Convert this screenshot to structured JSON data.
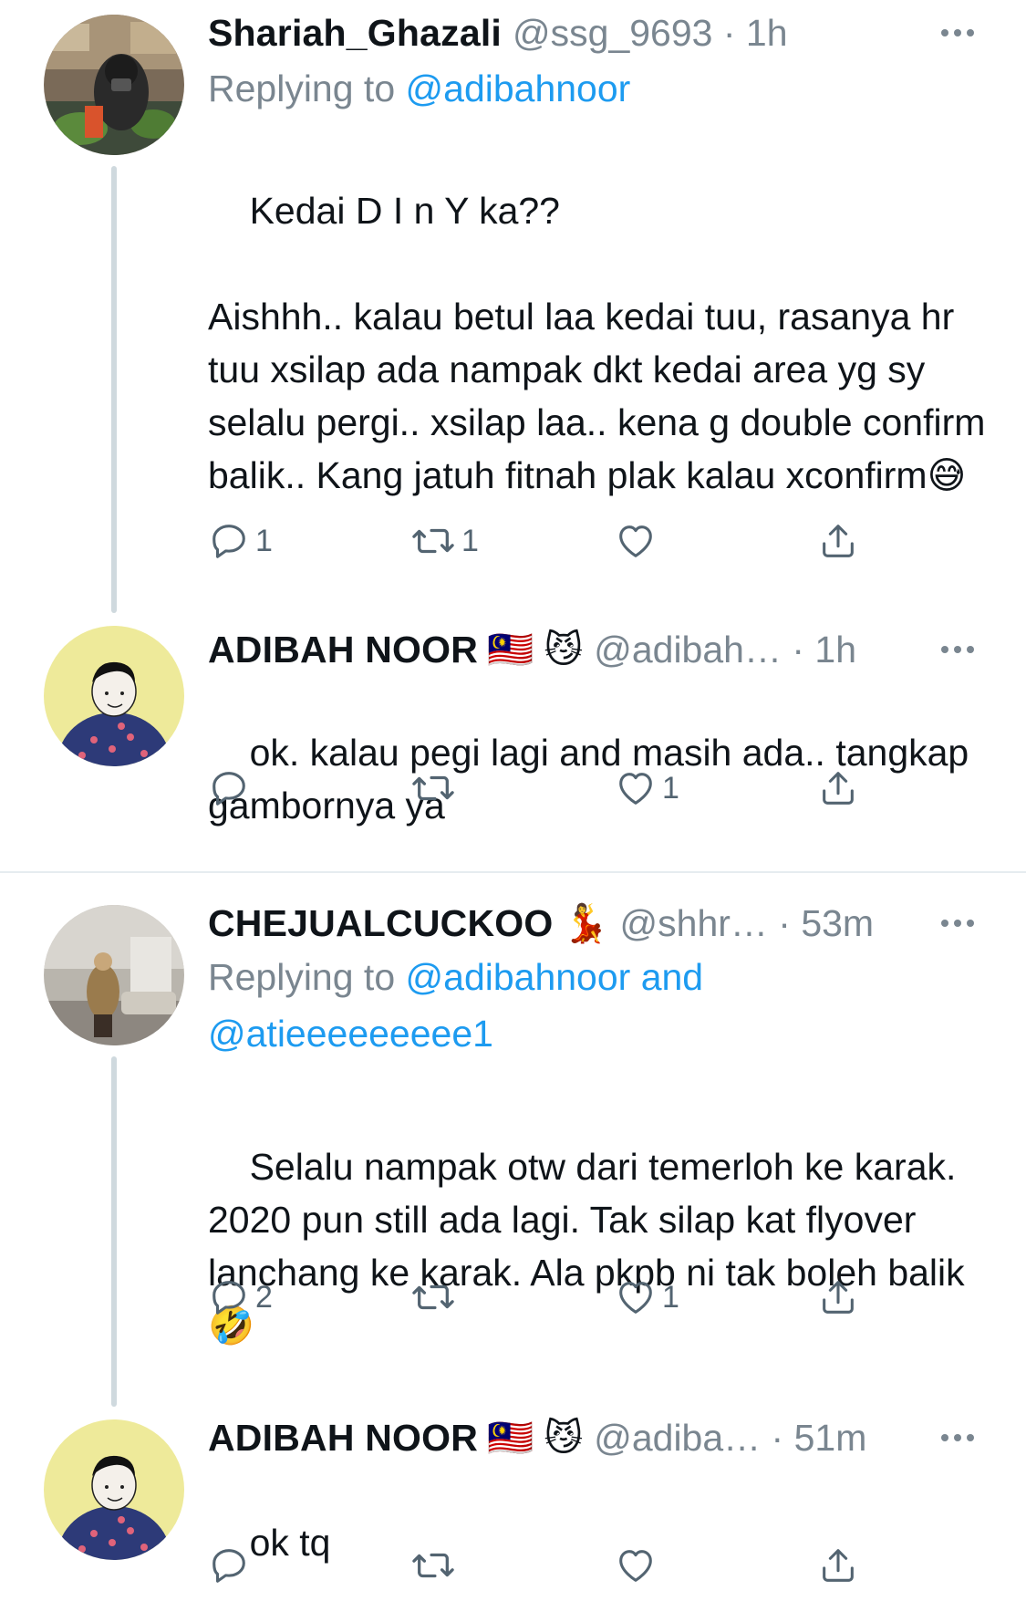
{
  "tweets": [
    {
      "name": "Shariah_Ghazali",
      "meta": "@ssg_9693 · 1h",
      "reply_prefix": "Replying to ",
      "reply_mentions": "@adibahnoor",
      "text": "Kedai D I n Y ka??\n\nAishhh.. kalau betul laa kedai tuu, rasanya hr tuu xsilap ada nampak dkt kedai area yg sy selalu pergi.. xsilap laa.. kena g double confirm balik.. Kang jatuh fitnah plak kalau xconfirm",
      "text_emoji": "😅",
      "reply_count": "1",
      "retweet_count": "1",
      "like_count": ""
    },
    {
      "name": "ADIBAH NOOR",
      "name_emoji": "🇲🇾 😼",
      "meta": "@adibah… · 1h",
      "text": "ok. kalau pegi lagi and masih ada.. tangkap gambornya ya",
      "reply_count": "",
      "retweet_count": "",
      "like_count": "1"
    },
    {
      "name": "CHEJUALCUCKOO",
      "name_emoji": "💃",
      "meta": "@shhr… · 53m",
      "reply_prefix": "Replying to ",
      "reply_mentions": "@adibahnoor and @atieeeeeeeee1",
      "text": "Selalu nampak otw dari temerloh ke karak. 2020 pun still ada lagi. Tak silap kat flyover lanchang ke karak. Ala pkpb ni tak boleh balik",
      "text_emoji": "🤣",
      "reply_count": "2",
      "retweet_count": "",
      "like_count": "1"
    },
    {
      "name": "ADIBAH NOOR",
      "name_emoji": "🇲🇾 😼",
      "meta": "@adiba… · 51m",
      "text": "ok tq",
      "reply_count": "",
      "retweet_count": "",
      "like_count": ""
    }
  ],
  "colors": {
    "text": "#0f1419",
    "muted": "#7a8690",
    "link": "#1d9bf0",
    "thread_line": "#cfd9de",
    "divider": "#e6ecf0"
  }
}
